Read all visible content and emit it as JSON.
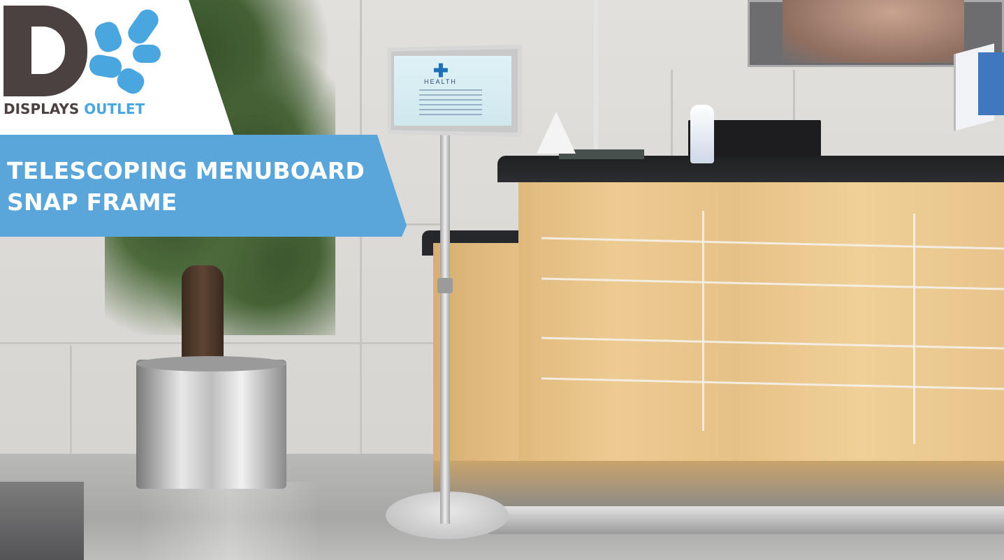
{
  "logo": {
    "mark": "DC",
    "word1": "DISPLAYS",
    "word2": "OUTLET"
  },
  "banner": {
    "line1": "TELESCOPING MENUBOARD",
    "line2": "SNAP FRAME"
  },
  "poster": {
    "title": "HEALTH"
  },
  "colors": {
    "brand_blue": "#4aa6df",
    "brand_dark": "#4a4140",
    "banner_blue": "#5aa6da"
  }
}
